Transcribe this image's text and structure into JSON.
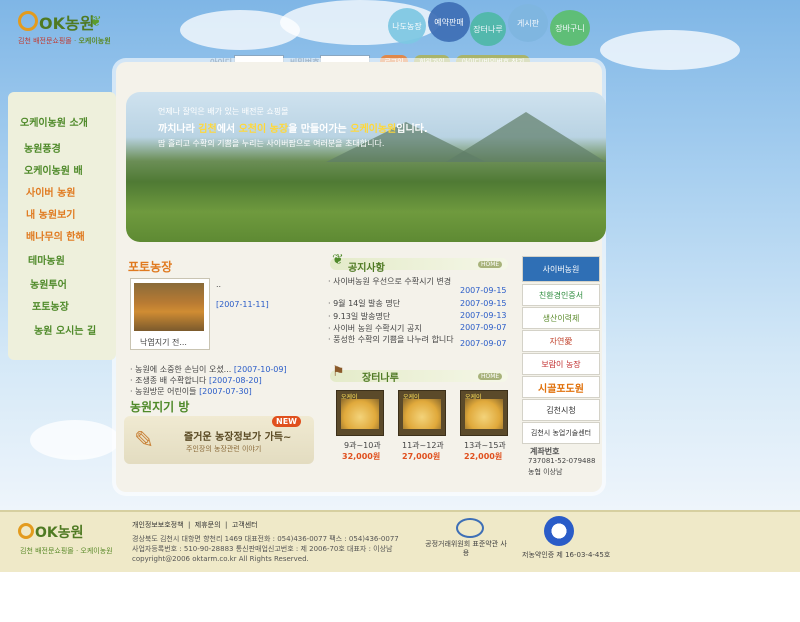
{
  "logo": {
    "name": "OK농원",
    "sub_a": "김천 배전문쇼핑몰",
    "sub_b": "오케이농원"
  },
  "topnav": [
    {
      "label": "나도농장",
      "color": "#7ec8e3"
    },
    {
      "label": "예약판매",
      "color": "#3e6fb6"
    },
    {
      "label": "장터나루",
      "color": "#4fb8a8"
    },
    {
      "label": "게시판",
      "color": "#7fb6e0"
    },
    {
      "label": "장바구니",
      "color": "#5cbf6e"
    }
  ],
  "login": {
    "id_label": "아이디",
    "pw_label": "비밀번호",
    "login_btn": "로그인",
    "join_btn": "회원가입",
    "find_btn": "아이디/비밀번호 찾기"
  },
  "hero": {
    "line1": "언제나 잘익은 배가 있는 배전문 쇼핑몰",
    "line2_a": "까치나라 ",
    "line2_b": "김천",
    "line2_c": "에서 ",
    "line2_d": "오천이 농장",
    "line2_e": "을 만들어가는 ",
    "line2_f": "오케이농원",
    "line2_g": "입니다.",
    "line3": "땀 흘리고 수확의 기쁨을 누리는 사이버팜으로 여러분을 초대합니다."
  },
  "sidebar": {
    "items": [
      {
        "label": "오케이농원 소개",
        "color": "#4f8a2a"
      },
      {
        "label": "농원풍경",
        "color": "#4f8a2a"
      },
      {
        "label": "오케이농원 배",
        "color": "#4f8a2a"
      },
      {
        "label": "사이버 농원",
        "color": "#e07a20"
      },
      {
        "label": "내 농원보기",
        "color": "#e07a20"
      },
      {
        "label": "배나무의 한해",
        "color": "#e07a20"
      },
      {
        "label": "테마농원",
        "color": "#4f8a2a"
      },
      {
        "label": "농원투어",
        "color": "#4f8a2a"
      },
      {
        "label": "포토농장",
        "color": "#4f8a2a"
      },
      {
        "label": "농원 오시는 길",
        "color": "#4f8a2a"
      }
    ]
  },
  "photo": {
    "title": "포토농장",
    "dots": "..",
    "date": "[2007-11-11]",
    "caption": "낙엽지기 전..."
  },
  "photo_list": [
    {
      "text": "· 농원에 소중한 손님이 오셨...",
      "date": "[2007-10-09]"
    },
    {
      "text": "· 조생종 배 수확합니다",
      "date": "[2007-08-20]"
    },
    {
      "text": "· 농원방문 어린이들",
      "date": "[2007-07-30]"
    }
  ],
  "board_title": "농원지기 방",
  "board": {
    "new": "NEW",
    "title": "즐거운 농장정보가 가득~",
    "sub": "주인장의 농장관련 이야기"
  },
  "notice": {
    "title": "공지사항",
    "more": "HOME",
    "items": [
      {
        "text": "· 사이버농원 우선으로 수확시기 변경",
        "date": "2007-09-15"
      },
      {
        "text": "· 9월 14일 발송 명단",
        "date": "2007-09-15"
      },
      {
        "text": "· 9.13일 발송명단",
        "date": "2007-09-13"
      },
      {
        "text": "· 사이버 농원 수확시기 공지",
        "date": "2007-09-07"
      },
      {
        "text": "· 풍성한 수확의 기쁨을 나누려 합니다",
        "date": "2007-09-07"
      }
    ]
  },
  "market": {
    "title": "장터나루",
    "more": "HOME",
    "products": [
      {
        "count": "9과~10과",
        "price": "32,000원",
        "tag": "오케이"
      },
      {
        "count": "11과~12과",
        "price": "27,000원",
        "tag": "오케이"
      },
      {
        "count": "13과~15과",
        "price": "22,000원",
        "tag": "오케이"
      }
    ]
  },
  "banners": [
    {
      "label": "사이버농원"
    },
    {
      "label": "친환경인증서"
    },
    {
      "label": "생산이력제"
    },
    {
      "label": "자연愛"
    },
    {
      "label": "보람이 농장"
    },
    {
      "label": "시골포도원"
    },
    {
      "label": "김천시청"
    },
    {
      "label": "김천시 농업기술센터"
    }
  ],
  "account": {
    "title": "계좌번호",
    "number": "737081-52-079488",
    "holder": "농협 이상남"
  },
  "footer": {
    "logo": "OK농원",
    "sub": "김천 배전문쇼핑몰 · 오케이농원",
    "links": [
      "개인정보보호정책",
      "제휴문의",
      "고객센터"
    ],
    "line1": "경상북도 김천시 대항면 향천리 1469 대표전화 : 054)436-0077 팩스 : 054)436-0077",
    "line2": "사업자등록번호 : 510-90-28883 통신판매업신고번호 : 제 2006-70호 대표자 : 이상남",
    "line3": "copyright@2006 oktarm.co.kr All Rights Reserved.",
    "fair_trade": "공정거래위원회 표준약관 사용",
    "cert": "저농약인증 제 16-03-4-45호"
  }
}
